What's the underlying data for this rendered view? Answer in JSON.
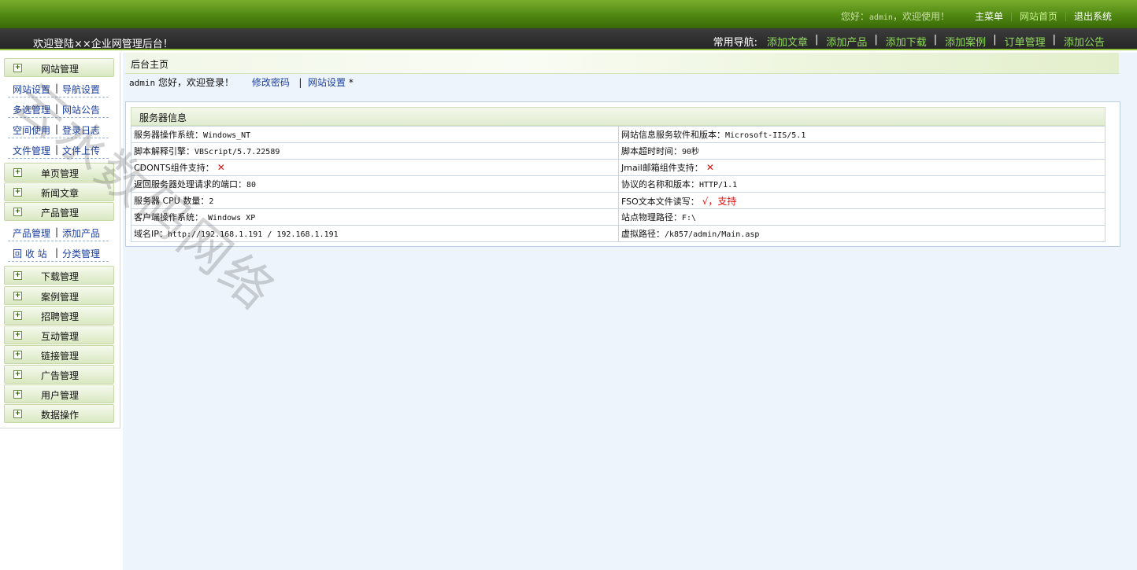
{
  "header": {
    "greeting_prefix": "您好：",
    "greeting_user": "admin",
    "greeting_suffix": "，欢迎使用！",
    "links": [
      "主菜单",
      "网站首页",
      "退出系统"
    ]
  },
  "subheader": {
    "welcome": "欢迎登陆××企业网管理后台！",
    "nav_label": "常用导航:",
    "nav_links": [
      "添加文章",
      "添加产品",
      "添加下载",
      "添加案例",
      "订单管理",
      "添加公告"
    ],
    "separator": "|"
  },
  "sidebar": {
    "site": {
      "title": "网站管理",
      "links": [
        [
          "网站设置",
          "导航设置"
        ],
        [
          "多选管理",
          "网站公告"
        ],
        [
          "空间使用",
          "登录日志"
        ],
        [
          "文件管理",
          "文件上传"
        ]
      ]
    },
    "single_page": "单页管理",
    "news": "新闻文章",
    "product": {
      "title": "产品管理",
      "links": [
        [
          "产品管理",
          "添加产品"
        ],
        [
          "回 收 站",
          "分类管理"
        ]
      ]
    },
    "rest": [
      "下载管理",
      "案例管理",
      "招聘管理",
      "互动管理",
      "链接管理",
      "广告管理",
      "用户管理",
      "数据操作"
    ],
    "pipe": "|",
    "plus": "+"
  },
  "main": {
    "title": "后台主页",
    "user": "admin",
    "user_greeting": " 您好，欢迎登录！",
    "change_password": "修改密码",
    "pipe": "|",
    "site_settings": "网站设置",
    "star": "*",
    "panel_title": "服务器信息",
    "rows": [
      {
        "l_label": "服务器操作系统：",
        "l_value": "Windows_NT",
        "r_label": "网站信息服务软件和版本：",
        "r_value": "Microsoft-IIS/5.1"
      },
      {
        "l_label": "脚本解释引擎：",
        "l_value": "VBScript/5.7.22589",
        "r_label": "脚本超时时间：",
        "r_value": "90秒"
      },
      {
        "l_label": "CDONTS组件支持：",
        "l_value": "✕",
        "r_label": "Jmail邮箱组件支持：",
        "r_value": "✕"
      },
      {
        "l_label": "返回服务器处理请求的端口：",
        "l_value": "80",
        "r_label": "协议的名称和版本：",
        "r_value": "HTTP/1.1"
      },
      {
        "l_label": "服务器 CPU 数量：",
        "l_value": "2",
        "r_label": "FSO文本文件读写：",
        "r_value": "√，支持"
      },
      {
        "l_label": "客户端操作系统：",
        "l_value": " Windows XP",
        "r_label": "站点物理路径：",
        "r_value": "F:\\"
      },
      {
        "l_label": "域名IP：",
        "l_value": "http://192.168.1.191 / 192.168.1.191",
        "r_label": "虚拟路径：",
        "r_value": "/k857/admin/Main.asp"
      }
    ]
  },
  "watermark": "云水数码网络"
}
